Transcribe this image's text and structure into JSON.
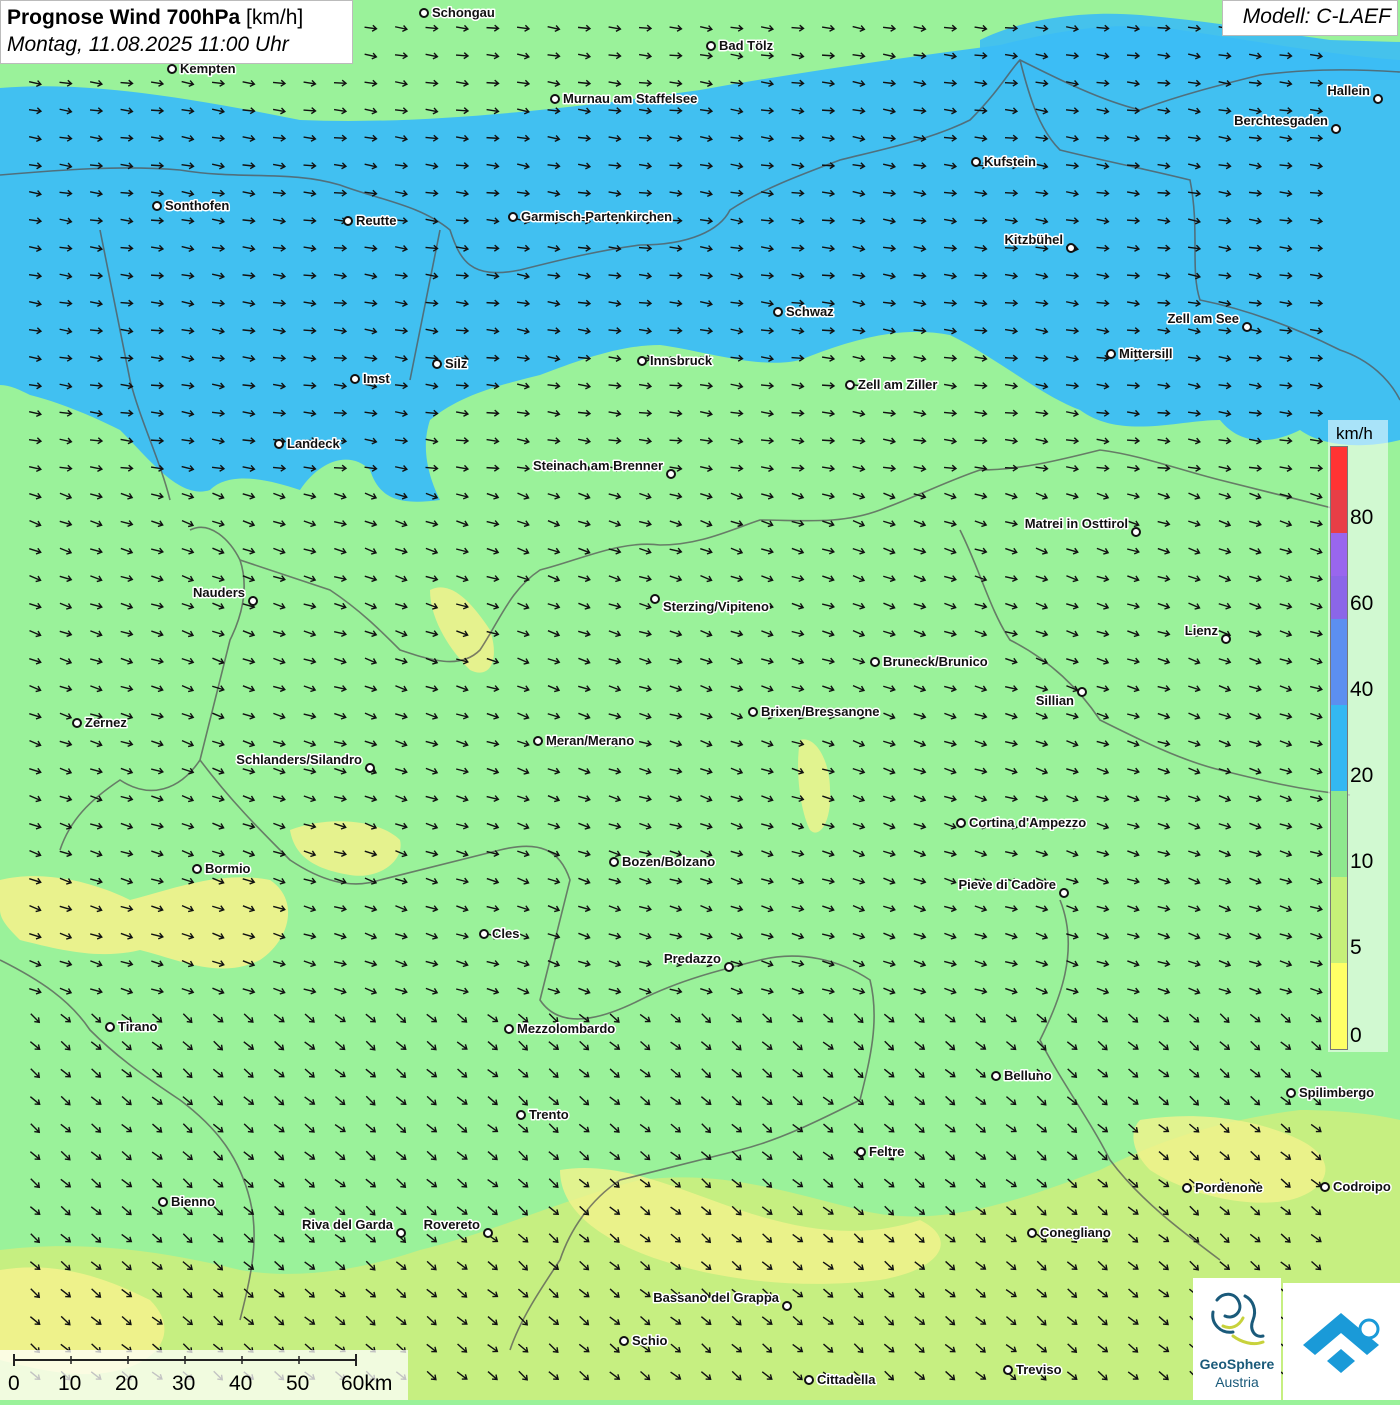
{
  "header": {
    "title": "Prognose Wind 700hPa",
    "title_unit": "[km/h]",
    "subtitle": "Montag, 11.08.2025 11:00 Uhr",
    "model": "Modell: C-LAEF"
  },
  "legend": {
    "unit": "km/h",
    "segments": [
      {
        "max": 90,
        "color": "#ff3333"
      },
      {
        "max": 80,
        "color": "#e83e46"
      },
      {
        "max": 70,
        "color": "#9966ee"
      },
      {
        "max": 60,
        "color": "#8b66e8"
      },
      {
        "max": 50,
        "color": "#5c8ff0"
      },
      {
        "max": 40,
        "color": "#5c8ff0"
      },
      {
        "max": 30,
        "color": "#34b8f2"
      },
      {
        "max": 20,
        "color": "#34b8f2"
      },
      {
        "max": 15,
        "color": "#8ee88e"
      },
      {
        "max": 10,
        "color": "#8ee88e"
      },
      {
        "max": 7,
        "color": "#c6f078"
      },
      {
        "max": 5,
        "color": "#c6f078"
      },
      {
        "max": 2,
        "color": "#ffff66"
      },
      {
        "max": 0,
        "color": "#ffff66"
      }
    ],
    "labels": [
      "80",
      "60",
      "40",
      "20",
      "10",
      "5",
      "0"
    ]
  },
  "scalebar": {
    "labels": [
      "0",
      "10",
      "20",
      "30",
      "40",
      "50",
      "60km"
    ]
  },
  "logo": {
    "name_line1": "GeoSphere",
    "name_line2": "Austria"
  },
  "colors": {
    "land_green": "#9af29a",
    "wind_blue": "#3cbdf5",
    "yellow": "#f2f28c",
    "lime": "#c8ee80",
    "border": "#555555"
  },
  "cities": [
    {
      "name": "Schongau"
    },
    {
      "name": "Bad Tölz"
    },
    {
      "name": "Kempten"
    },
    {
      "name": "Hallein"
    },
    {
      "name": "Murnau am Staffelsee"
    },
    {
      "name": "Berchtesgaden"
    },
    {
      "name": "Kufstein"
    },
    {
      "name": "Sonthofen"
    },
    {
      "name": "Reutte"
    },
    {
      "name": "Garmisch-Partenkirchen"
    },
    {
      "name": "Kitzbühel"
    },
    {
      "name": "Schwaz"
    },
    {
      "name": "Zell am See"
    },
    {
      "name": "Mittersill"
    },
    {
      "name": "Innsbruck"
    },
    {
      "name": "Silz"
    },
    {
      "name": "Imst"
    },
    {
      "name": "Zell am Ziller"
    },
    {
      "name": "Landeck"
    },
    {
      "name": "Steinach am Brenner"
    },
    {
      "name": "Matrei in Osttirol"
    },
    {
      "name": "Nauders"
    },
    {
      "name": "Sterzing/Vipiteno"
    },
    {
      "name": "Lienz"
    },
    {
      "name": "Bruneck/Brunico"
    },
    {
      "name": "Sillian"
    },
    {
      "name": "Brixen/Bressanone"
    },
    {
      "name": "Zernez"
    },
    {
      "name": "Meran/Merano"
    },
    {
      "name": "Schlanders/Silandro"
    },
    {
      "name": "Cortina d'Ampezzo"
    },
    {
      "name": "Bozen/Bolzano"
    },
    {
      "name": "Bormio"
    },
    {
      "name": "Pieve di Cadore"
    },
    {
      "name": "Cles"
    },
    {
      "name": "Predazzo"
    },
    {
      "name": "Tirano"
    },
    {
      "name": "Mezzolombardo"
    },
    {
      "name": "Belluno"
    },
    {
      "name": "Spilimbergo"
    },
    {
      "name": "Trento"
    },
    {
      "name": "Feltre"
    },
    {
      "name": "Pordenone"
    },
    {
      "name": "Codroipo"
    },
    {
      "name": "Bienno"
    },
    {
      "name": "Riva del Garda"
    },
    {
      "name": "Rovereto"
    },
    {
      "name": "Conegliano"
    },
    {
      "name": "Bassano del Grappa"
    },
    {
      "name": "Schio"
    },
    {
      "name": "Treviso"
    },
    {
      "name": "Cittadella"
    }
  ]
}
